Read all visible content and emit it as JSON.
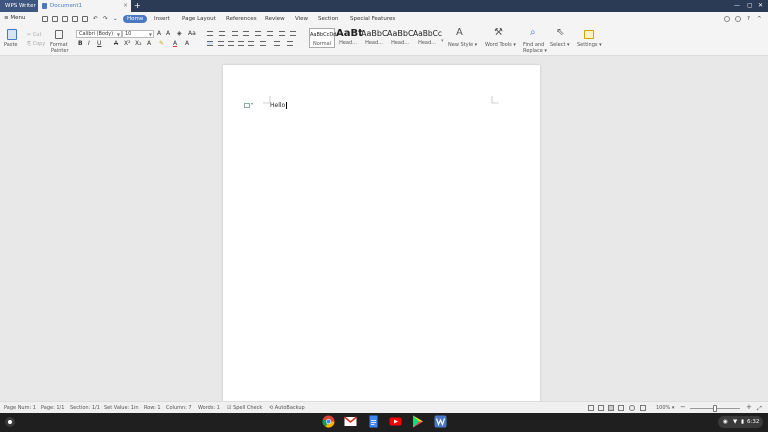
{
  "window": {
    "app_tab": "WPS Writer",
    "doc_tab": "Document1",
    "new_tab": "+",
    "doc_close": "×",
    "win_controls": [
      "—",
      "▢",
      "✕"
    ]
  },
  "menu": {
    "menu_label": "≡ Menu",
    "tabs": [
      "Home",
      "Insert",
      "Page Layout",
      "References",
      "Review",
      "View",
      "Section",
      "Special Features"
    ]
  },
  "ribbon": {
    "paste": "Paste",
    "cut": "Cut",
    "copy": "Copy",
    "format_painter": [
      "Format",
      "Painter"
    ],
    "font_name": "Calibri (Body)",
    "font_size": "10",
    "styles": [
      {
        "sample": "AaBbCcDd",
        "name": "Normal"
      },
      {
        "sample": "AaBt",
        "name": "Head..."
      },
      {
        "sample": "AaBbC",
        "name": "Head..."
      },
      {
        "sample": "AaBbC",
        "name": "Head..."
      },
      {
        "sample": "AaBbCc",
        "name": "Head..."
      }
    ],
    "new_style": "New Style",
    "word_tools": "Word Tools",
    "find_replace": [
      "Find and",
      "Replace"
    ],
    "select": "Select",
    "settings": "Settings"
  },
  "document": {
    "text": "Hello"
  },
  "status": {
    "page_num": "Page Num: 1",
    "page": "Page: 1/1",
    "section": "Section: 1/1",
    "set_value": "Set Value: 1in",
    "row": "Row: 1",
    "column": "Column: 7",
    "words": "Words: 1",
    "spell_check": "Spell Check",
    "autobackup": "AutoBackup",
    "zoom": "100%",
    "zoom_level": 0.5
  },
  "shelf": {
    "apps": [
      "chrome-icon",
      "gmail-icon",
      "docs-icon",
      "youtube-icon",
      "play-store-icon",
      "wps-writer-icon"
    ],
    "time": "6:32"
  },
  "colors": {
    "accent": "#4a78c2",
    "titlebar": "#2b3a55",
    "shelf": "#1f1f1f"
  }
}
